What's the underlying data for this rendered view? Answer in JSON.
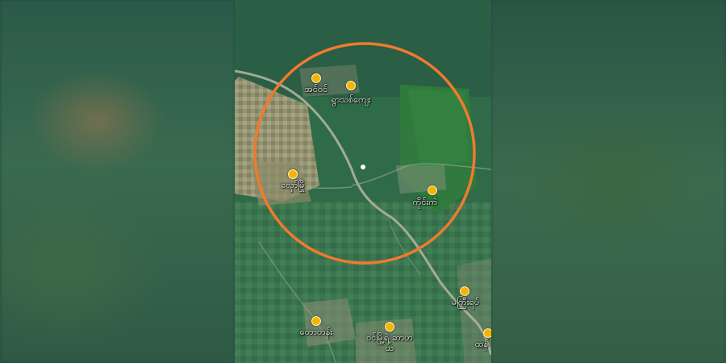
{
  "map": {
    "places": [
      {
        "id": "p1",
        "name": "အင်ဝင်"
      },
      {
        "id": "p2",
        "name": "ရွာသစ်ကျေး"
      },
      {
        "id": "p3",
        "name": "လှော်မြို"
      },
      {
        "id": "p4",
        "name": "ကိုင်းကဲ"
      },
      {
        "id": "p5",
        "name": "မကြီးရပ်"
      },
      {
        "id": "p6",
        "name": "တောတန်း"
      },
      {
        "id": "p7",
        "name": "ဝင်မြို့ရဲ့ ဆာဟယ"
      },
      {
        "id": "p8",
        "name": "ထန်"
      }
    ],
    "radius_circle_color": "#f07a2e",
    "pin_color": "#f5b400"
  }
}
